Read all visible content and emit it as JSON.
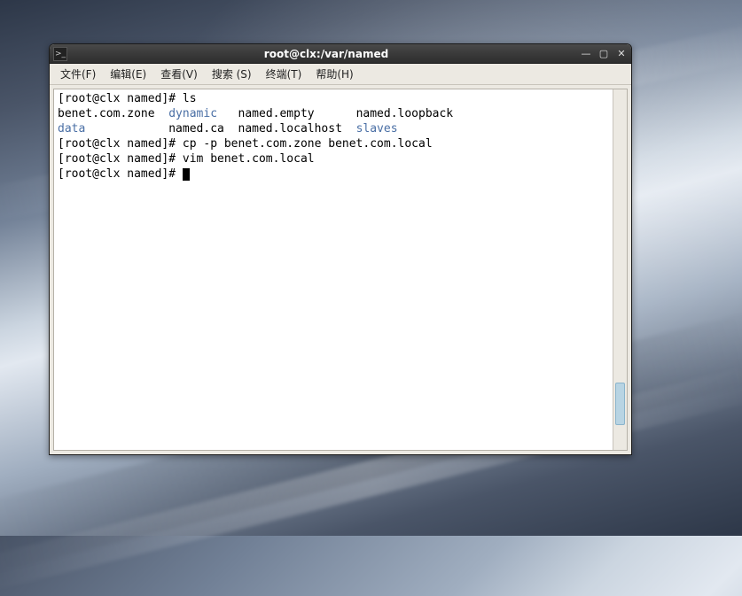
{
  "window": {
    "title": "root@clx:/var/named"
  },
  "menubar": {
    "file": "文件(F)",
    "edit": "编辑(E)",
    "view": "查看(V)",
    "search": "搜索 (S)",
    "terminal": "终端(T)",
    "help": "帮助(H)"
  },
  "terminal": {
    "l1_prompt": "[root@clx named]# ",
    "l1_cmd": "ls",
    "l2_a": "benet.com.zone  ",
    "l2_b": "dynamic",
    "l2_c": "   named.empty      named.loopback",
    "l3_a": "data",
    "l3_b": "            named.ca  named.localhost  ",
    "l3_c": "slaves",
    "l4_prompt": "[root@clx named]# ",
    "l4_cmd": "cp -p benet.com.zone benet.com.local",
    "l5_prompt": "[root@clx named]# ",
    "l5_cmd": "vim benet.com.local",
    "l6_prompt": "[root@clx named]# "
  }
}
